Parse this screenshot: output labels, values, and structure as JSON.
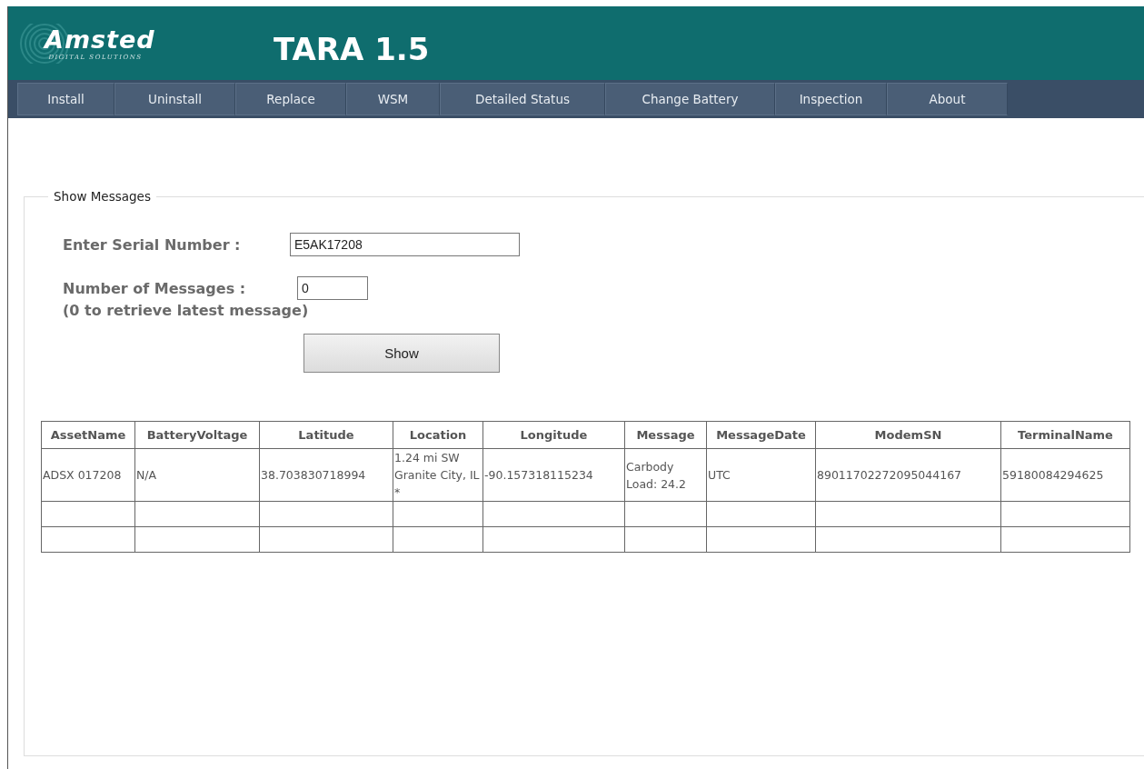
{
  "header": {
    "logo": {
      "brand": "Amsted",
      "tagline": "DIGITAL SOLUTIONS"
    },
    "title": "TARA 1.5"
  },
  "tabs": [
    {
      "label": "Install"
    },
    {
      "label": "Uninstall"
    },
    {
      "label": "Replace"
    },
    {
      "label": "WSM"
    },
    {
      "label": "Detailed Status"
    },
    {
      "label": "Change Battery"
    },
    {
      "label": "Inspection"
    },
    {
      "label": "About"
    }
  ],
  "group": {
    "title": "Show Messages",
    "serial": {
      "label": "Enter Serial Number :",
      "value": "E5AK17208"
    },
    "count": {
      "label": "Number of Messages :",
      "value": "0",
      "hint": "(0 to retrieve latest message)"
    },
    "button": "Show"
  },
  "table": {
    "columns": [
      "AssetName",
      "BatteryVoltage",
      "Latitude",
      "Location",
      "Longitude",
      "Message",
      "MessageDate",
      "ModemSN",
      "TerminalName"
    ],
    "rows": [
      [
        "ADSX 017208",
        "N/A",
        "38.703830718994",
        "1.24 mi SW Granite City, IL *",
        "-90.157318115234",
        "Carbody Load: 24.2",
        "UTC",
        "89011702272095044167",
        "59180084294625"
      ],
      [
        "",
        "",
        "",
        "",
        "",
        "",
        "",
        "",
        ""
      ],
      [
        "",
        "",
        "",
        "",
        "",
        "",
        "",
        "",
        ""
      ]
    ]
  }
}
